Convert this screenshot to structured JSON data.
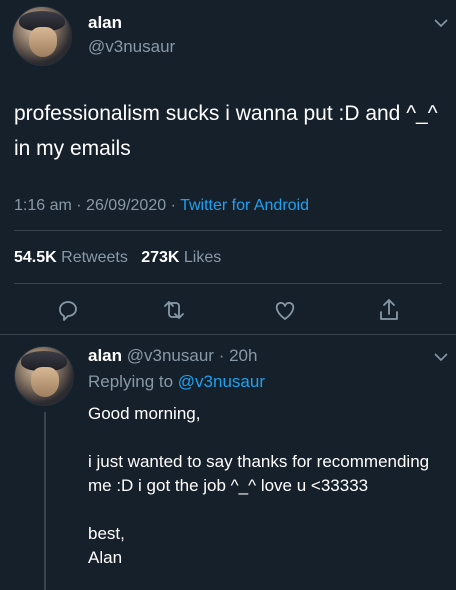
{
  "tweet": {
    "author_name": "alan",
    "author_handle": "@v3nusaur",
    "text": "professionalism sucks i wanna put :D and ^_^ in my emails",
    "time": "1:16 am",
    "date": "26/09/2020",
    "source": "Twitter for Android",
    "retweets_count": "54.5K",
    "retweets_label": "Retweets",
    "likes_count": "273K",
    "likes_label": "Likes"
  },
  "reply": {
    "author_name": "alan",
    "author_handle": "@v3nusaur",
    "age": "20h",
    "replying_prefix": "Replying to",
    "replying_handle": "@v3nusaur",
    "lines": [
      "Good morning,",
      "i just wanted to say thanks for recommending me :D i got the job ^_^ love u <33333",
      "best,",
      "Alan"
    ]
  },
  "icons": {
    "reply": "reply-icon",
    "retweet": "retweet-icon",
    "like": "heart-icon",
    "share": "share-icon",
    "more": "chevron-down-icon"
  },
  "colors": {
    "background": "#15202b",
    "muted": "#8899a6",
    "accent": "#1da1f2",
    "divider": "#38444d"
  }
}
